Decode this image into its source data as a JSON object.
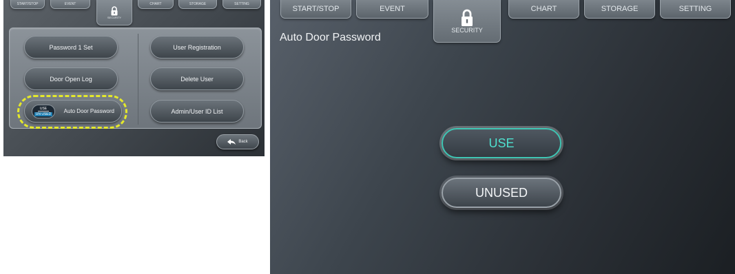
{
  "left": {
    "tabs": {
      "start_stop": "START/STOP",
      "event": "EVENT",
      "security": "SECURITY",
      "chart": "CHART",
      "storage": "STORAGE",
      "setting": "SETTING"
    },
    "buttons": {
      "password_set": "Password 1 Set",
      "user_registration": "User Registration",
      "door_open_log": "Door Open Log",
      "delete_user": "Delete User",
      "auto_door_password": "Auto Door Password",
      "admin_user_id_list": "Admin/User ID List"
    },
    "toggle": {
      "use": "USE",
      "unused": "UN USED"
    },
    "back_label": "Back"
  },
  "right": {
    "tabs": {
      "start_stop": "START/STOP",
      "event": "EVENT",
      "security": "SECURITY",
      "chart": "CHART",
      "storage": "STORAGE",
      "setting": "SETTING"
    },
    "page_title": "Auto Door Password",
    "options": {
      "use": "USE",
      "unused": "UNUSED"
    }
  },
  "colors": {
    "accent_teal": "#3fc6b4",
    "highlight_yellow": "#e4e82b"
  },
  "icons": {
    "security_tab": "lock-icon",
    "back_button": "back-arrow-icon"
  }
}
